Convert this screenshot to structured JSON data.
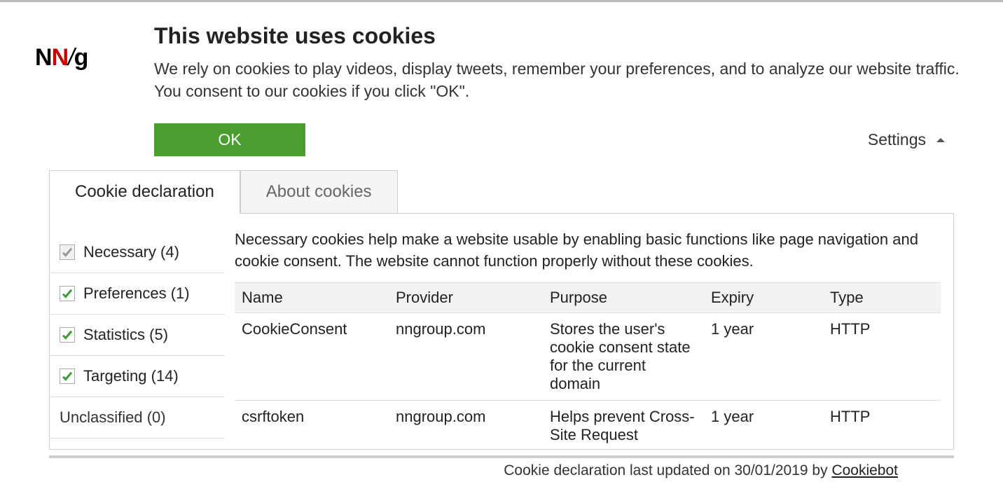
{
  "logo": {
    "n1": "N",
    "n2": "N",
    "slash": "/",
    "g": "g"
  },
  "header": {
    "title": "This website uses cookies",
    "description": "We rely on cookies to play videos, display tweets, remember your preferences, and to analyze our website traffic. You consent to our cookies if you click \"OK\"."
  },
  "controls": {
    "ok_label": "OK",
    "settings_label": "Settings"
  },
  "tabs": [
    {
      "label": "Cookie declaration",
      "active": true
    },
    {
      "label": "About cookies",
      "active": false
    }
  ],
  "categories": [
    {
      "label": "Necessary (4)",
      "state": "disabled"
    },
    {
      "label": "Preferences (1)",
      "state": "checked"
    },
    {
      "label": "Statistics (5)",
      "state": "checked"
    },
    {
      "label": "Targeting (14)",
      "state": "checked"
    },
    {
      "label": "Unclassified (0)",
      "state": "none"
    }
  ],
  "category_description": "Necessary cookies help make a website usable by enabling basic functions like page navigation and cookie consent. The website cannot function properly without these cookies.",
  "table": {
    "headers": [
      "Name",
      "Provider",
      "Purpose",
      "Expiry",
      "Type"
    ],
    "rows": [
      {
        "name": "CookieConsent",
        "provider": "nngroup.com",
        "purpose": "Stores the user's cookie consent state for the current domain",
        "expiry": "1 year",
        "type": "HTTP"
      },
      {
        "name": "csrftoken",
        "provider": "nngroup.com",
        "purpose": "Helps prevent Cross-Site Request",
        "expiry": "1 year",
        "type": "HTTP"
      }
    ]
  },
  "footer": {
    "prefix": "Cookie declaration last updated on 30/01/2019 by ",
    "link": "Cookiebot"
  }
}
